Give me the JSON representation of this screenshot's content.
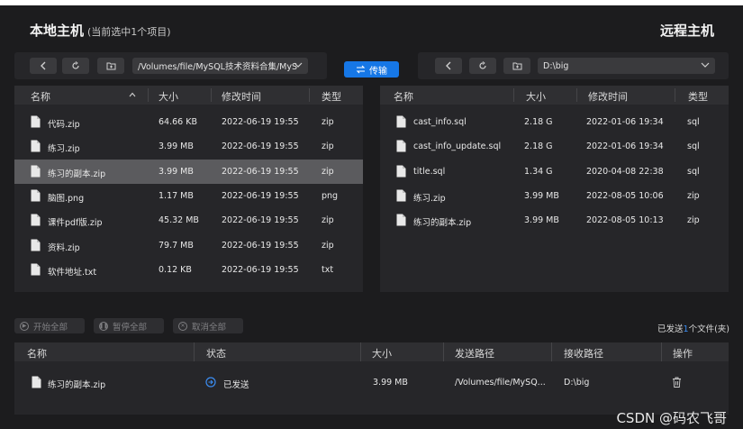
{
  "local": {
    "title": "本地主机",
    "subtitle": "(当前选中1个项目)",
    "path": "/Volumes/file/MySQL技术资料合集/MyS",
    "columns": [
      "名称",
      "大小",
      "修改时间",
      "类型"
    ],
    "files": [
      {
        "name": "代码.zip",
        "size": "64.66 KB",
        "modified": "2022-06-19 19:55",
        "type": "zip",
        "selected": false
      },
      {
        "name": "练习.zip",
        "size": "3.99 MB",
        "modified": "2022-06-19 19:55",
        "type": "zip",
        "selected": false
      },
      {
        "name": "练习的副本.zip",
        "size": "3.99 MB",
        "modified": "2022-06-19 19:55",
        "type": "zip",
        "selected": true
      },
      {
        "name": "脑图.png",
        "size": "1.17 MB",
        "modified": "2022-06-19 19:55",
        "type": "png",
        "selected": false
      },
      {
        "name": "课件pdf版.zip",
        "size": "45.32 MB",
        "modified": "2022-06-19 19:55",
        "type": "zip",
        "selected": false
      },
      {
        "name": "资料.zip",
        "size": "79.7 MB",
        "modified": "2022-06-19 19:55",
        "type": "zip",
        "selected": false
      },
      {
        "name": "软件地址.txt",
        "size": "0.12 KB",
        "modified": "2022-06-19 19:55",
        "type": "txt",
        "selected": false
      }
    ]
  },
  "transfer_label": "传输",
  "remote": {
    "title": "远程主机",
    "path": "D:\\big",
    "columns": [
      "名称",
      "大小",
      "修改时间",
      "类型"
    ],
    "files": [
      {
        "name": "cast_info.sql",
        "size": "2.18 G",
        "modified": "2022-01-06 19:34",
        "type": "sql"
      },
      {
        "name": "cast_info_update.sql",
        "size": "2.18 G",
        "modified": "2022-01-06 19:34",
        "type": "sql"
      },
      {
        "name": "title.sql",
        "size": "1.34 G",
        "modified": "2020-04-08 22:38",
        "type": "sql"
      },
      {
        "name": "练习.zip",
        "size": "3.99 MB",
        "modified": "2022-08-05 10:06",
        "type": "zip"
      },
      {
        "name": "练习的副本.zip",
        "size": "3.99 MB",
        "modified": "2022-08-05 10:13",
        "type": "zip"
      }
    ]
  },
  "actions": {
    "start_all": "开始全部",
    "pause_all": "暂停全部",
    "cancel_all": "取消全部"
  },
  "queue_status": {
    "prefix": "已发送",
    "count": "1",
    "suffix": "个文件(夹)"
  },
  "queue": {
    "columns": [
      "名称",
      "状态",
      "大小",
      "发送路径",
      "接收路径",
      "操作"
    ],
    "rows": [
      {
        "name": "练习的副本.zip",
        "status": "已发送",
        "size": "3.99 MB",
        "send_path": "/Volumes/file/MySQ...",
        "recv_path": "D:\\big"
      }
    ]
  },
  "watermark": "CSDN @码农飞哥",
  "colors": {
    "accent": "#1677e6",
    "background": "#1c1c1e",
    "panel": "#262629",
    "selected_row": "#5b5b5e"
  }
}
